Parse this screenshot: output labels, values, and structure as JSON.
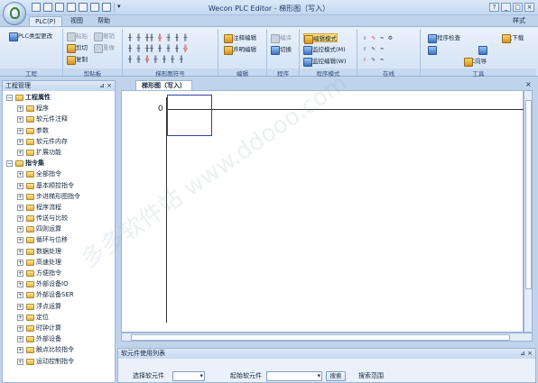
{
  "window": {
    "title": "Wecon PLC Editor - 梯形图（写入）",
    "style_label": "样式"
  },
  "tabs": [
    {
      "label": "PLC(P)"
    },
    {
      "label": "视图"
    },
    {
      "label": "帮助"
    }
  ],
  "ribbon": {
    "project": {
      "label": "工程",
      "plc_type_change": "PLC类型更改"
    },
    "clipboard": {
      "label": "剪贴板",
      "paste": "粘贴",
      "undo": "撤销",
      "cut": "剪切",
      "redo": "重做",
      "copy": "复制"
    },
    "ladder_symbols": {
      "label": "梯形图符号"
    },
    "edit": {
      "label": "编辑",
      "comment_edit": "注释编辑",
      "statement_edit": "声明编辑"
    },
    "program": {
      "label": "程序",
      "compile": "编译",
      "switch": "切换"
    },
    "program_mode": {
      "label": "程序模式",
      "edit_mode": "编辑模式",
      "monitor_mode": "监控模式(M)",
      "monitor_edit": "监控编辑(W)"
    },
    "online": {
      "label": "在线"
    },
    "tools": {
      "label": "工具",
      "program_check": "程序检查",
      "u_download": "U盘下载",
      "plc_wizard": "PLC向导"
    }
  },
  "project_panel": {
    "title": "工程管理",
    "pin": "⊿ × ",
    "tree": [
      {
        "label": "工程属性",
        "level": 0,
        "bold": true
      },
      {
        "label": "程序",
        "level": 1
      },
      {
        "label": "软元件注释",
        "level": 1
      },
      {
        "label": "参数",
        "level": 1
      },
      {
        "label": "软元件内存",
        "level": 1
      },
      {
        "label": "扩展功能",
        "level": 1
      },
      {
        "label": "指令集",
        "level": 0,
        "bold": true
      },
      {
        "label": "全部指令",
        "level": 1
      },
      {
        "label": "基本顺控指令",
        "level": 1
      },
      {
        "label": "步进梯形图指令",
        "level": 1
      },
      {
        "label": "程序流程",
        "level": 1
      },
      {
        "label": "传送与比较",
        "level": 1
      },
      {
        "label": "四则运算",
        "level": 1
      },
      {
        "label": "循环与位移",
        "level": 1
      },
      {
        "label": "数据处理",
        "level": 1
      },
      {
        "label": "高速处理",
        "level": 1
      },
      {
        "label": "方便指令",
        "level": 1
      },
      {
        "label": "外部设备IO",
        "level": 1
      },
      {
        "label": "外部设备SER",
        "level": 1
      },
      {
        "label": "浮点运算",
        "level": 1
      },
      {
        "label": "定位",
        "level": 1
      },
      {
        "label": "时钟计算",
        "level": 1
      },
      {
        "label": "外部设备",
        "level": 1
      },
      {
        "label": "触点比较指令",
        "level": 1
      },
      {
        "label": "运动控制指令",
        "level": 1
      }
    ]
  },
  "document": {
    "tab": "梯形图（写入）",
    "rung_number": "0",
    "close": "×"
  },
  "bottom_panel": {
    "title": "软元件使用列表",
    "pin": "⊿ ×",
    "select_label": "选择软元件",
    "start_label": "起始软元件",
    "search_button": "搜索",
    "range_label": "搜索范围"
  },
  "watermark": "多多软件站 www.ddooo.com"
}
